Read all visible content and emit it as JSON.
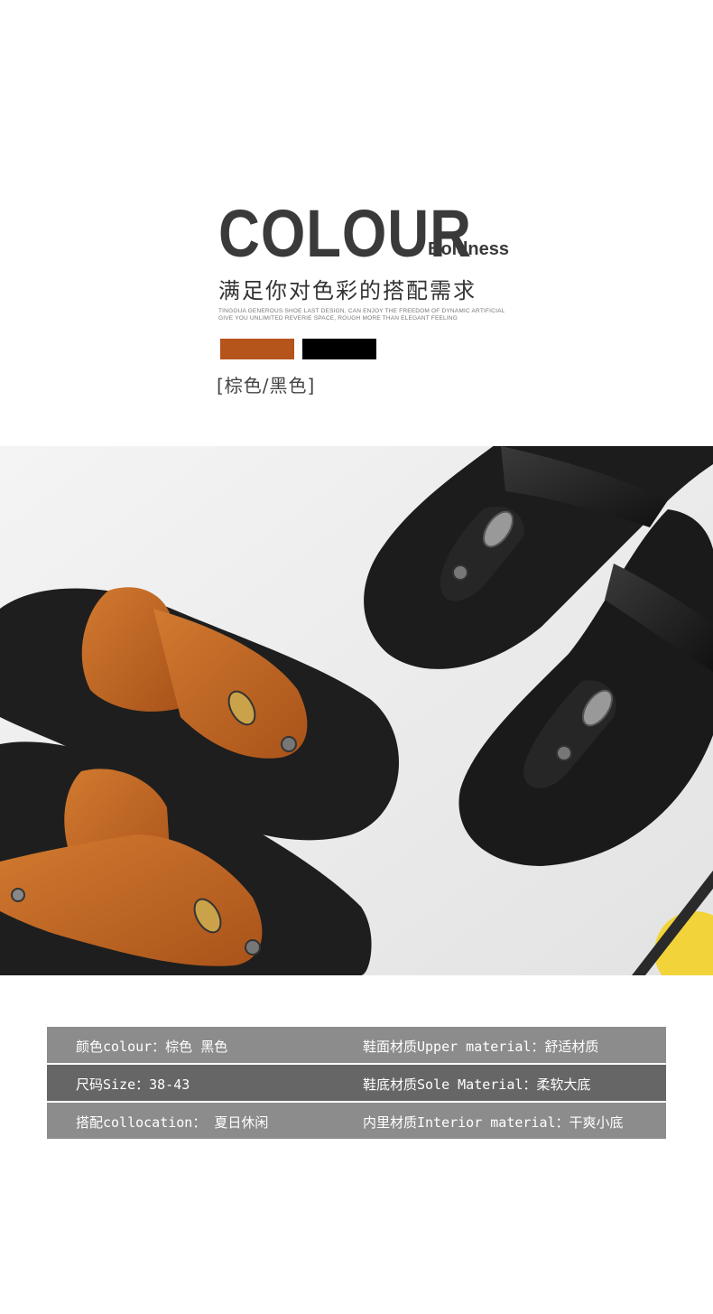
{
  "header": {
    "title": "COLOUR",
    "title_sub": "Boldness",
    "subtitle_cn": "满足你对色彩的搭配需求",
    "small_en_line1": "TINGGUA GENEROUS SHOE LAST DESIGN, CAN ENJOY THE FREEDOM OF DYNAMIC ARTIFICIAL",
    "small_en_line2": "GIVE YOU UNLIMITED REVERIE SPACE, ROUGH MORE THAN ELEGANT FEELING"
  },
  "swatches": [
    {
      "name": "brown",
      "color": "#b5541b"
    },
    {
      "name": "black",
      "color": "#000000"
    }
  ],
  "colors_label": "[棕色/黑色]",
  "photo": {
    "background": "#ededed",
    "brown_leather": "#c0651f",
    "black_leather": "#1a1a1a",
    "sole": "#1e1e1e"
  },
  "specs": [
    {
      "left": "颜色colour：棕色 黑色",
      "right": "鞋面材质Upper material：舒适材质"
    },
    {
      "left": "尺码Size：38-43",
      "right": "鞋底材质Sole Material：柔软大底"
    },
    {
      "left": "搭配collocation： 夏日休闲",
      "right": "内里材质Interior material：干爽小底"
    }
  ]
}
